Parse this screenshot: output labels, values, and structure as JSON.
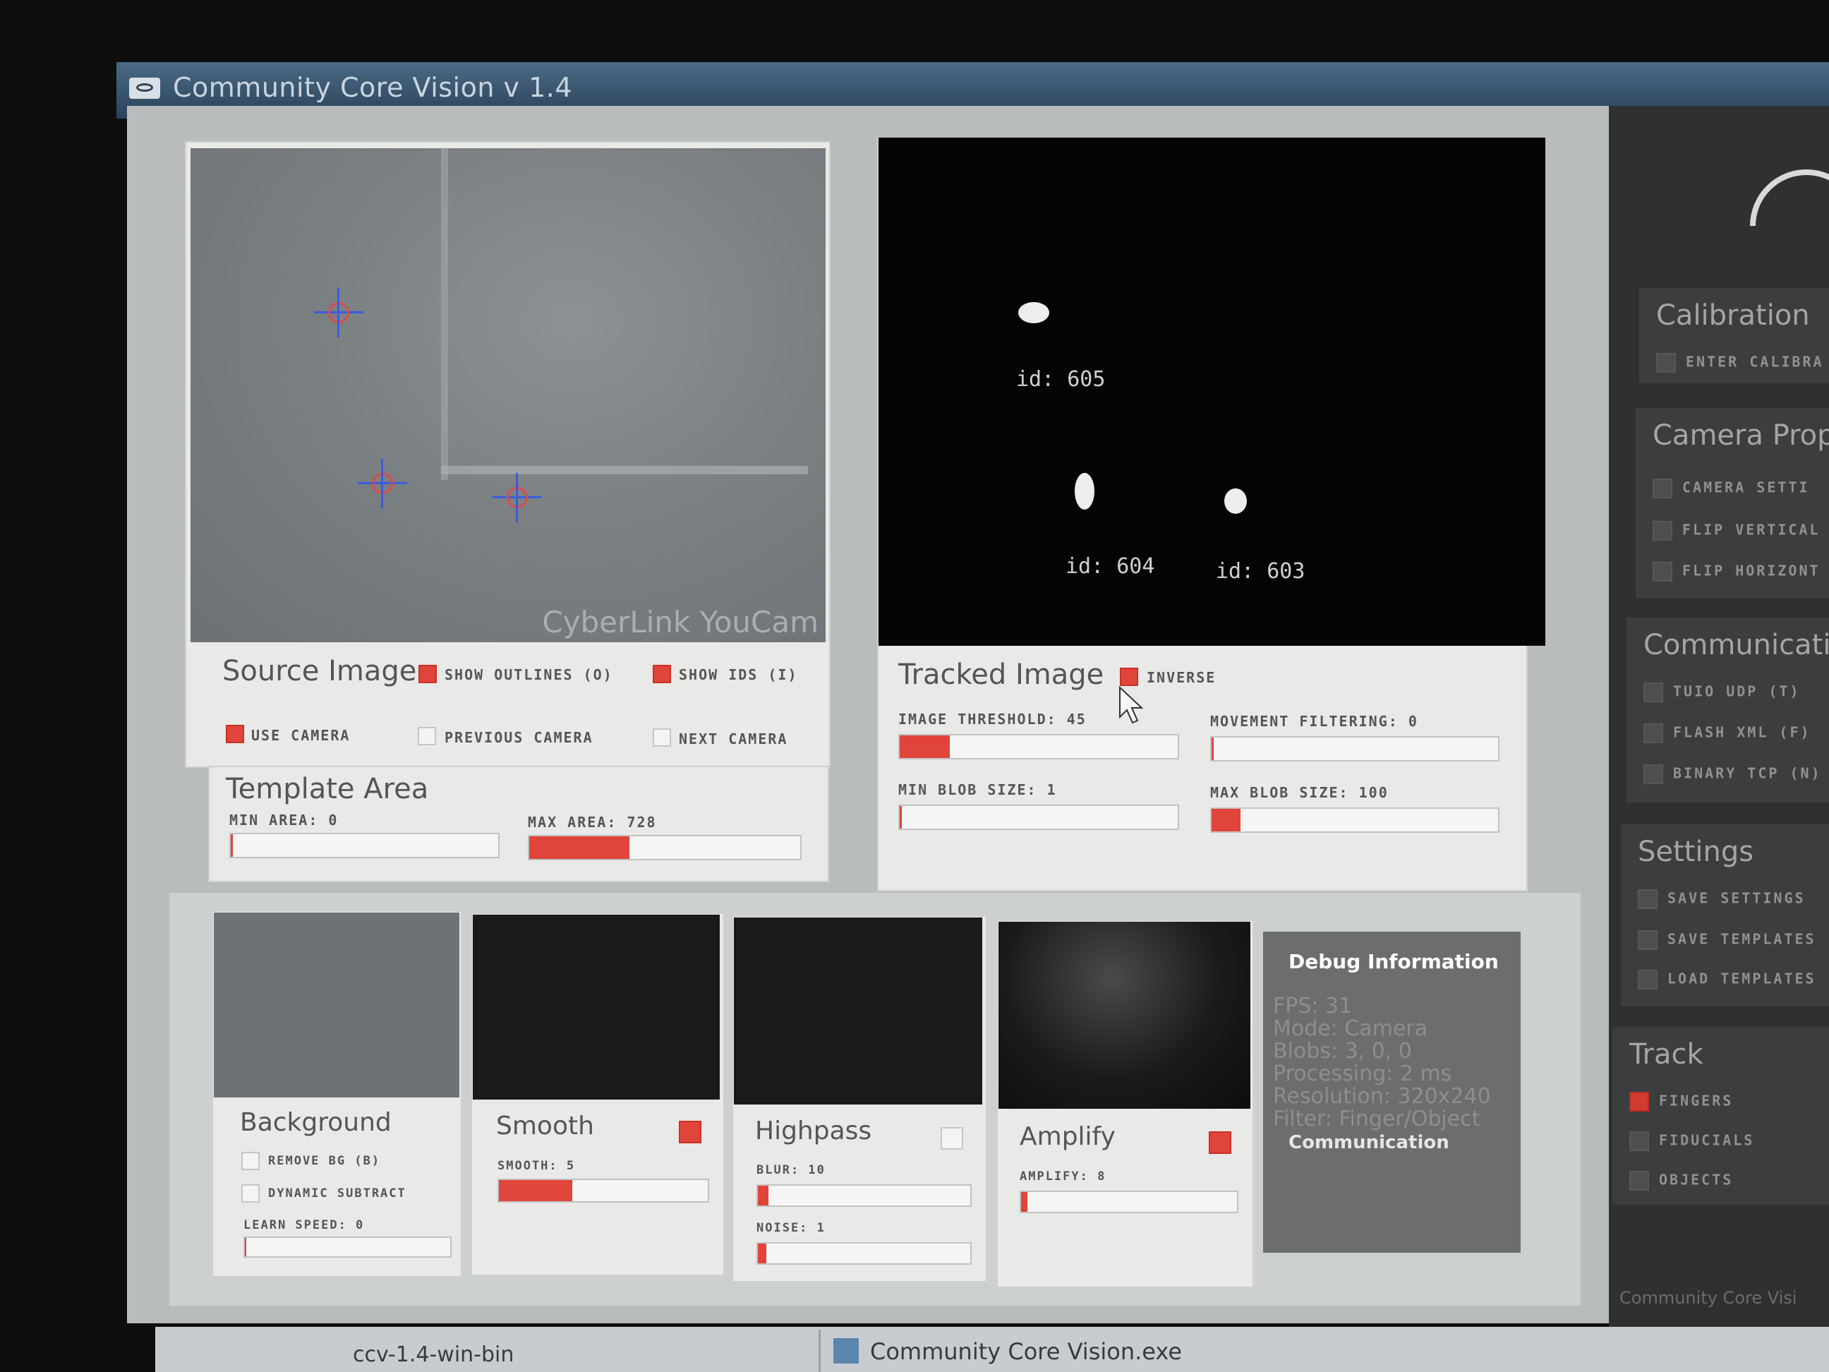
{
  "window": {
    "title": "Community Core Vision v 1.4"
  },
  "source": {
    "title": "Source Image",
    "watermark": "CyberLink YouCam",
    "show_outlines": {
      "label": "SHOW OUTLINES (O)",
      "checked": true
    },
    "show_ids": {
      "label": "SHOW IDS (I)",
      "checked": true
    },
    "use_camera": {
      "label": "USE CAMERA",
      "checked": true
    },
    "previous_camera": {
      "label": "PREVIOUS CAMERA",
      "checked": false
    },
    "next_camera": {
      "label": "NEXT CAMERA",
      "checked": false
    }
  },
  "template": {
    "title": "Template Area",
    "min_area": {
      "label": "MIN AREA: 0",
      "value": 0,
      "fraction": 0.0
    },
    "max_area": {
      "label": "MAX AREA: 728",
      "value": 728,
      "fraction": 0.37
    }
  },
  "tracked": {
    "title": "Tracked Image",
    "inverse": {
      "label": "INVERSE",
      "checked": true
    },
    "image_threshold": {
      "label": "IMAGE THRESHOLD: 45",
      "value": 45,
      "fraction": 0.18
    },
    "movement_filtering": {
      "label": "MOVEMENT FILTERING: 0",
      "value": 0,
      "fraction": 0.0
    },
    "min_blob_size": {
      "label": "MIN BLOB SIZE: 1",
      "value": 1,
      "fraction": 0.0
    },
    "max_blob_size": {
      "label": "MAX BLOB SIZE: 100",
      "value": 100,
      "fraction": 0.1
    },
    "blobs": [
      {
        "id_label": "id: 605"
      },
      {
        "id_label": "id: 604"
      },
      {
        "id_label": "id: 603"
      }
    ]
  },
  "filters": {
    "background": {
      "title": "Background",
      "remove_bg": {
        "label": "REMOVE BG (B)",
        "checked": false
      },
      "dynamic_subtract": {
        "label": "DYNAMIC SUBTRACT",
        "checked": false
      },
      "learn_speed": {
        "label": "LEARN SPEED: 0",
        "value": 0,
        "fraction": 0.0
      }
    },
    "smooth": {
      "title": "Smooth",
      "enabled": true,
      "smooth": {
        "label": "SMOOTH: 5",
        "value": 5,
        "fraction": 0.35
      }
    },
    "highpass": {
      "title": "Highpass",
      "enabled": false,
      "blur": {
        "label": "BLUR: 10",
        "value": 10,
        "fraction": 0.05
      },
      "noise": {
        "label": "NOISE: 1",
        "value": 1,
        "fraction": 0.04
      }
    },
    "amplify": {
      "title": "Amplify",
      "enabled": true,
      "amplify": {
        "label": "AMPLIFY: 8",
        "value": 8,
        "fraction": 0.03
      }
    }
  },
  "debug": {
    "title": "Debug Information",
    "fps": "FPS: 31",
    "mode": "Mode: Camera",
    "blobs": "Blobs: 3, 0, 0",
    "processing": "Processing: 2 ms",
    "resolution": "Resolution: 320x240",
    "filter": "Filter: Finger/Object",
    "communication": "Communication"
  },
  "sidebar": {
    "calibration": {
      "title": "Calibration",
      "items": [
        {
          "label": "ENTER CALIBRA",
          "checked": false
        }
      ]
    },
    "camera": {
      "title": "Camera Prop",
      "items": [
        {
          "label": "CAMERA SETTI",
          "checked": false
        },
        {
          "label": "FLIP VERTICAL",
          "checked": false
        },
        {
          "label": "FLIP HORIZONT",
          "checked": false
        }
      ]
    },
    "communication": {
      "title": "Communicati",
      "items": [
        {
          "label": "TUIO UDP (T)",
          "checked": false
        },
        {
          "label": "FLASH XML (F)",
          "checked": false
        },
        {
          "label": "BINARY TCP (N)",
          "checked": false
        }
      ]
    },
    "settings": {
      "title": "Settings",
      "items": [
        {
          "label": "SAVE SETTINGS",
          "checked": false
        },
        {
          "label": "SAVE TEMPLATES",
          "checked": false
        },
        {
          "label": "LOAD TEMPLATES",
          "checked": false
        }
      ]
    },
    "track": {
      "title": "Track",
      "items": [
        {
          "label": "FINGERS",
          "checked": true
        },
        {
          "label": "FIDUCIALS",
          "checked": false
        },
        {
          "label": "OBJECTS",
          "checked": false
        }
      ]
    },
    "footer": "Community Core Visi"
  },
  "taskbar": {
    "left_text": "ccv-1.4-win-bin",
    "active_window": "Community Core Vision.exe"
  },
  "colors": {
    "accent": "#e1443a",
    "panel": "#e9e9e8",
    "sidebar": "#2e3031"
  }
}
